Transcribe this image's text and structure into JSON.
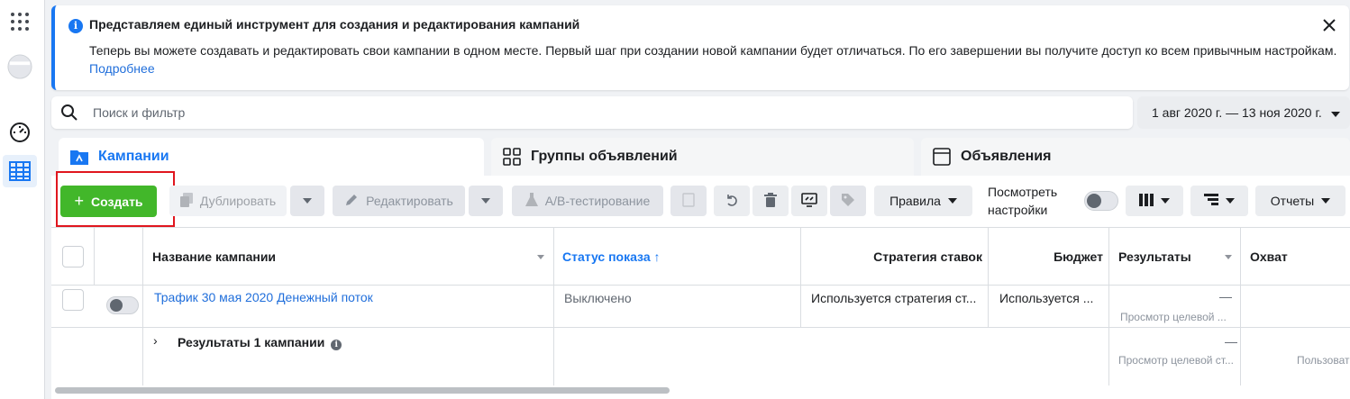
{
  "rail": {
    "icons": [
      "apps-grid-icon",
      "account-avatar-icon",
      "dashboard-gauge-icon",
      "table-grid-icon"
    ]
  },
  "notice": {
    "title": "Представляем единый инструмент для создания и редактирования кампаний",
    "body": "Теперь вы можете создавать и редактировать свои кампании в одном месте. Первый шаг при создании новой кампании будет отличаться. По его завершении вы получите доступ ко всем привычным настройкам.",
    "link": "Подробнее",
    "info_glyph": "i"
  },
  "search": {
    "placeholder": "Поиск и фильтр"
  },
  "date_range": "1 авг 2020 г. — 13 ноя 2020 г.",
  "tabs": [
    {
      "label": "Кампании",
      "active": true
    },
    {
      "label": "Группы объявлений",
      "active": false
    },
    {
      "label": "Объявления",
      "active": false
    }
  ],
  "toolbar": {
    "create": "Создать",
    "duplicate": "Дублировать",
    "edit": "Редактировать",
    "ab_test": "А/В-тестирование",
    "rules": "Правила",
    "view_settings": "Посмотреть настройки",
    "reports": "Отчеты"
  },
  "table": {
    "headers": {
      "name": "Название кампании",
      "status": "Статус показа",
      "bid": "Стратегия ставок",
      "budget": "Бюджет",
      "results": "Результаты",
      "reach": "Охват"
    },
    "row": {
      "name": "Трафик 30 мая 2020 Денежный поток",
      "status": "Выключено",
      "bid": "Используется стратегия ст...",
      "budget": "Используется ...",
      "results_value": "—",
      "results_sub": "Просмотр целевой ..."
    },
    "summary": {
      "label": "Результаты 1 кампании",
      "results_value": "—",
      "results_sub": "Просмотр целевой ст...",
      "reach_sub": "Пользоват"
    }
  },
  "colors": {
    "accent": "#1877f2",
    "create_green": "#42b72a",
    "highlight_red": "#e0161e"
  }
}
